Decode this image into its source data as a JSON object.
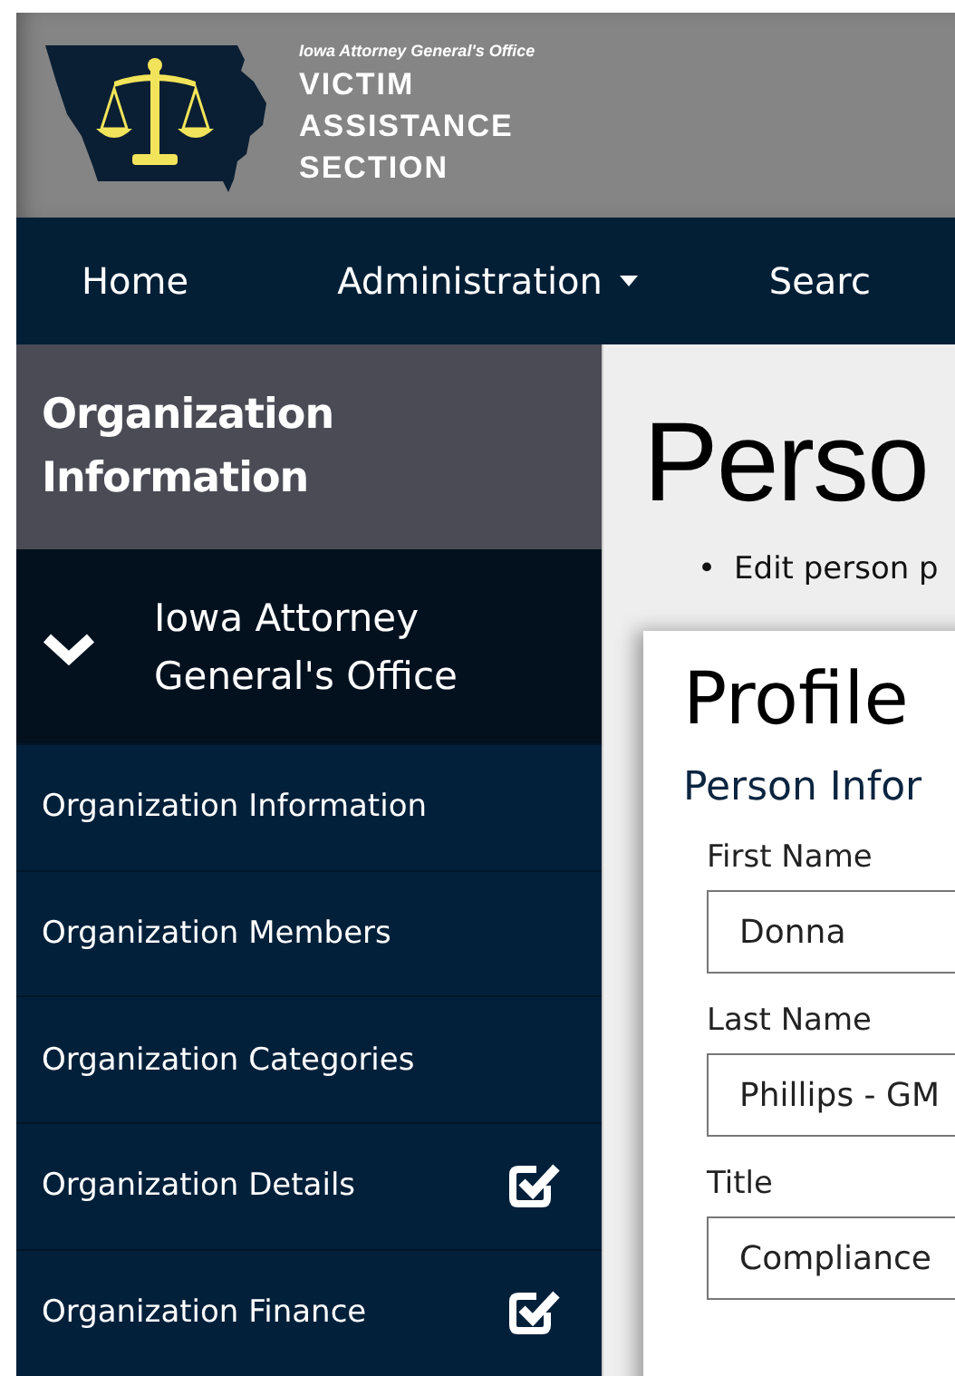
{
  "header": {
    "kicker": "Iowa Attorney General's Office",
    "title_lines": [
      "VICTIM",
      "ASSISTANCE",
      "SECTION"
    ]
  },
  "nav": [
    {
      "label": "Home",
      "dropdown": false
    },
    {
      "label": "Administration",
      "dropdown": true
    },
    {
      "label": "Searc",
      "dropdown": false
    }
  ],
  "sidebar": {
    "title": "Organization Information",
    "group": {
      "label": "Iowa Attorney General's Office",
      "expanded": true
    },
    "items": [
      {
        "label": "Organization Information",
        "checked": false
      },
      {
        "label": "Organization Members",
        "checked": false
      },
      {
        "label": "Organization Categories",
        "checked": false
      },
      {
        "label": "Organization Details",
        "checked": true
      },
      {
        "label": "Organization Finance",
        "checked": true
      }
    ]
  },
  "page": {
    "title": "Perso",
    "bullets": [
      {
        "marker": "•",
        "text": "Edit person p"
      }
    ]
  },
  "card": {
    "title": "Profile",
    "section": "Person Infor",
    "fields": [
      {
        "label": "First Name",
        "value": "Donna"
      },
      {
        "label": "Last Name",
        "value": "Phillips - GM"
      },
      {
        "label": "Title",
        "value": "Compliance"
      }
    ]
  }
}
